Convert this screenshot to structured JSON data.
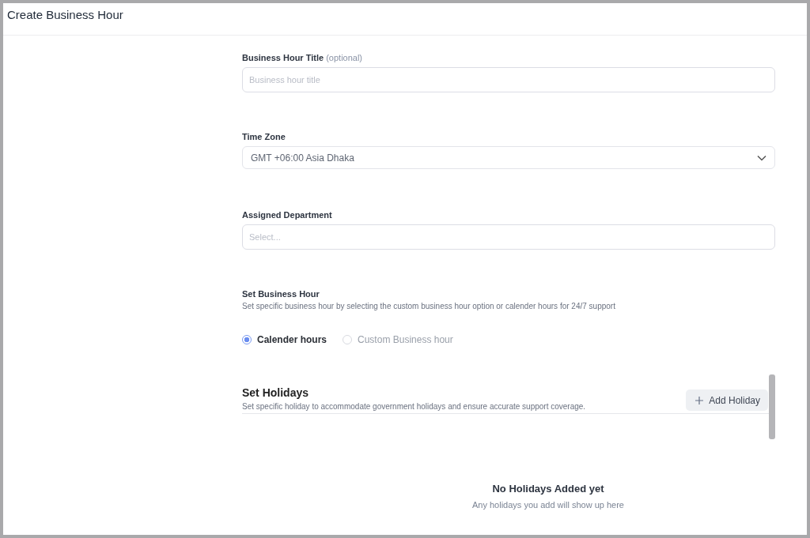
{
  "header": {
    "title": "Create Business Hour"
  },
  "fields": [
    {
      "kind": "input",
      "label": "Business Hour Title",
      "label_note": "(optional)",
      "placeholder": "Business hour title"
    },
    {
      "kind": "select",
      "label": "Time Zone",
      "value": "GMT +06:00 Asia Dhaka"
    },
    {
      "kind": "input",
      "label": "Assigned Department",
      "placeholder": "Select..."
    }
  ],
  "business_hour": {
    "title": "Set Business Hour",
    "description": "Set specific business hour by selecting the custom business hour option or calender hours for 24/7 support",
    "options": [
      {
        "label": "Calender hours",
        "selected": true
      },
      {
        "label": "Custom Business hour",
        "selected": false
      }
    ]
  },
  "holidays": {
    "title": "Set Holidays",
    "description": "Set specific holiday to accommodate government holidays and ensure accurate support coverage.",
    "button": "Add Holiday",
    "empty_title": "No Holidays Added yet",
    "empty_text": "Any holidays you add will show up here"
  }
}
